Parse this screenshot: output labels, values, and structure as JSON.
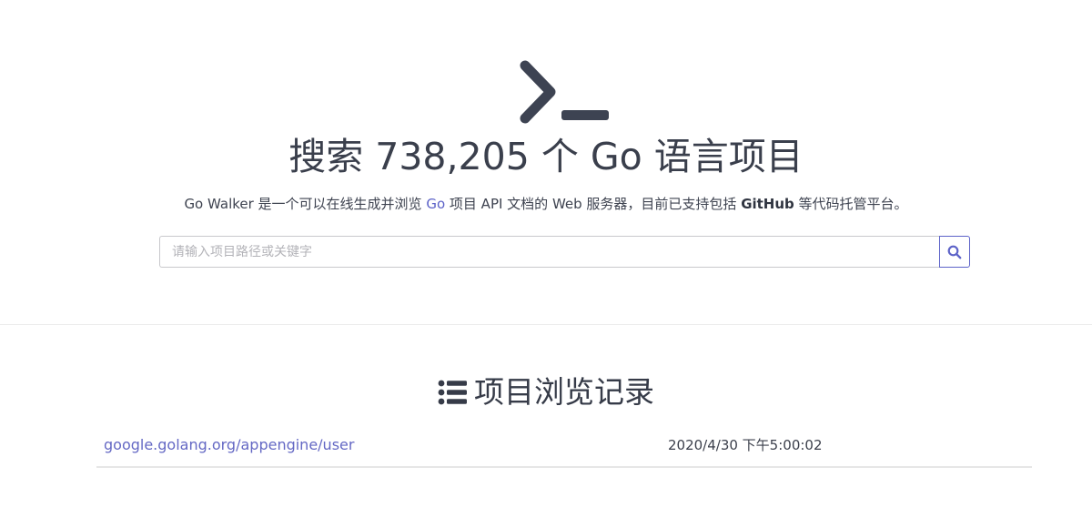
{
  "header": {
    "title_prefix": "搜索 ",
    "project_count": "738,205",
    "title_suffix": " 个 Go 语言项目"
  },
  "tagline": {
    "part1": "Go Walker 是一个可以在线生成并浏览 ",
    "go_link": "Go",
    "part2": " 项目 API 文档的 Web 服务器，目前已支持包括 ",
    "github": "GitHub",
    "part3": " 等代码托管平台。"
  },
  "search": {
    "placeholder": "请输入项目路径或关键字",
    "value": "",
    "button_icon": "search-icon"
  },
  "history": {
    "icon": "list-icon",
    "title": "项目浏览记录",
    "items": [
      {
        "path": "google.golang.org/appengine/user",
        "time": "2020/4/30 下午5:00:02"
      }
    ]
  },
  "colors": {
    "accent": "#5d63c8",
    "text": "#333a48",
    "logo": "#3d4352"
  }
}
